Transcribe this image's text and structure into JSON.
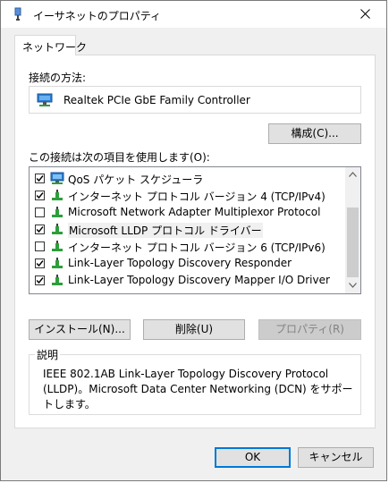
{
  "window": {
    "title": "イーサネットのプロパティ"
  },
  "tabs": [
    {
      "label": "ネットワーク"
    }
  ],
  "connection": {
    "label": "接続の方法:",
    "adapter_name": "Realtek PCIe GbE Family Controller",
    "configure_label": "構成(C)..."
  },
  "items_label": "この接続は次の項目を使用します(O):",
  "items": [
    {
      "label": "QoS パケット スケジューラ",
      "checked": true,
      "icon": "qos-icon"
    },
    {
      "label": "インターネット プロトコル バージョン 4 (TCP/IPv4)",
      "checked": true,
      "icon": "protocol-icon"
    },
    {
      "label": "Microsoft Network Adapter Multiplexor Protocol",
      "checked": false,
      "icon": "protocol-icon"
    },
    {
      "label": "Microsoft LLDP プロトコル ドライバー",
      "checked": true,
      "icon": "protocol-icon"
    },
    {
      "label": "インターネット プロトコル バージョン 6 (TCP/IPv6)",
      "checked": false,
      "icon": "protocol-icon"
    },
    {
      "label": "Link-Layer Topology Discovery Responder",
      "checked": true,
      "icon": "protocol-icon"
    },
    {
      "label": "Link-Layer Topology Discovery Mapper I/O Driver",
      "checked": true,
      "icon": "protocol-icon"
    }
  ],
  "actions": {
    "install_label": "インストール(N)...",
    "uninstall_label": "削除(U)",
    "properties_label": "プロパティ(R)"
  },
  "description": {
    "legend": "説明",
    "text": "IEEE 802.1AB Link-Layer Topology Discovery Protocol (LLDP)。Microsoft Data Center Networking (DCN) をサポートします。"
  },
  "footer": {
    "ok_label": "OK",
    "cancel_label": "キャンセル"
  },
  "colors": {
    "accent": "#0078d7",
    "protocol_icon_green": "#2e9e3c",
    "adapter_icon_blue": "#2a7bd1"
  }
}
